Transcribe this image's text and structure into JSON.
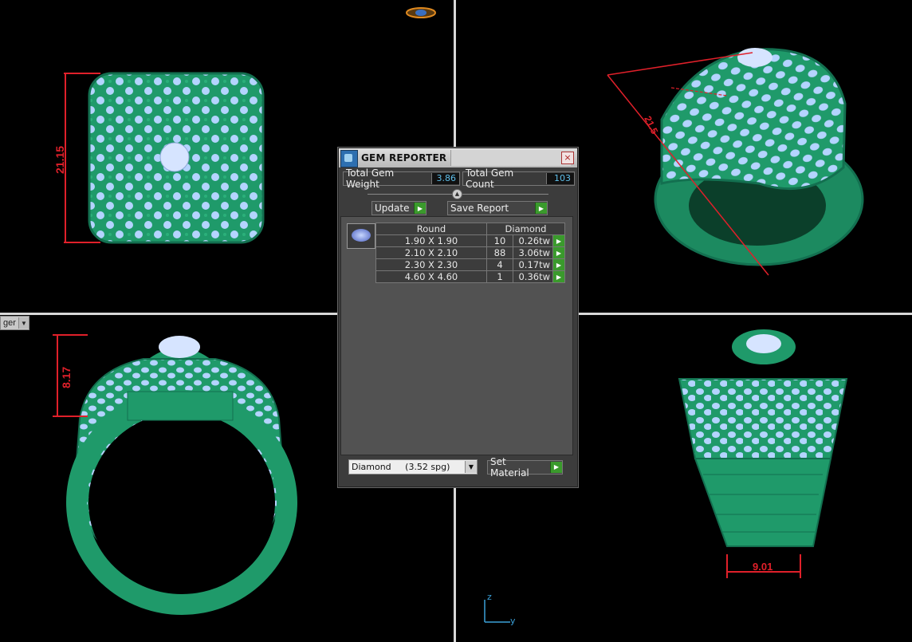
{
  "viewport_menu": {
    "label": "ger"
  },
  "dimensions": {
    "top_left_height": "21.15",
    "bottom_left_height": "8.17",
    "top_right_label": "21.5",
    "bottom_right_width": "9.01"
  },
  "axes": {
    "z": "z",
    "y": "y"
  },
  "gem_reporter": {
    "title": "GEM REPORTER",
    "close_glyph": "×",
    "total_weight_label": "Total Gem Weight",
    "total_weight_value": "3.86",
    "total_count_label": "Total Gem Count",
    "total_count_value": "103",
    "update_label": "Update",
    "save_report_label": "Save Report",
    "table": {
      "shape_header": "Round",
      "material_header": "Diamond",
      "rows": [
        {
          "size": "1.90 X 1.90",
          "count": "10",
          "weight": "0.26tw"
        },
        {
          "size": "2.10 X 2.10",
          "count": "88",
          "weight": "3.06tw"
        },
        {
          "size": "2.30 X 2.30",
          "count": "4",
          "weight": "0.17tw"
        },
        {
          "size": "4.60 X 4.60",
          "count": "1",
          "weight": "0.36tw"
        }
      ]
    },
    "material_select": "Diamond     (3.52 spg)",
    "set_material_label": "Set Material"
  },
  "colors": {
    "ring": "#1f9a6a",
    "gem": "#b4d4ff",
    "dimension": "#e0202a",
    "divider": "#d8d8d8"
  }
}
